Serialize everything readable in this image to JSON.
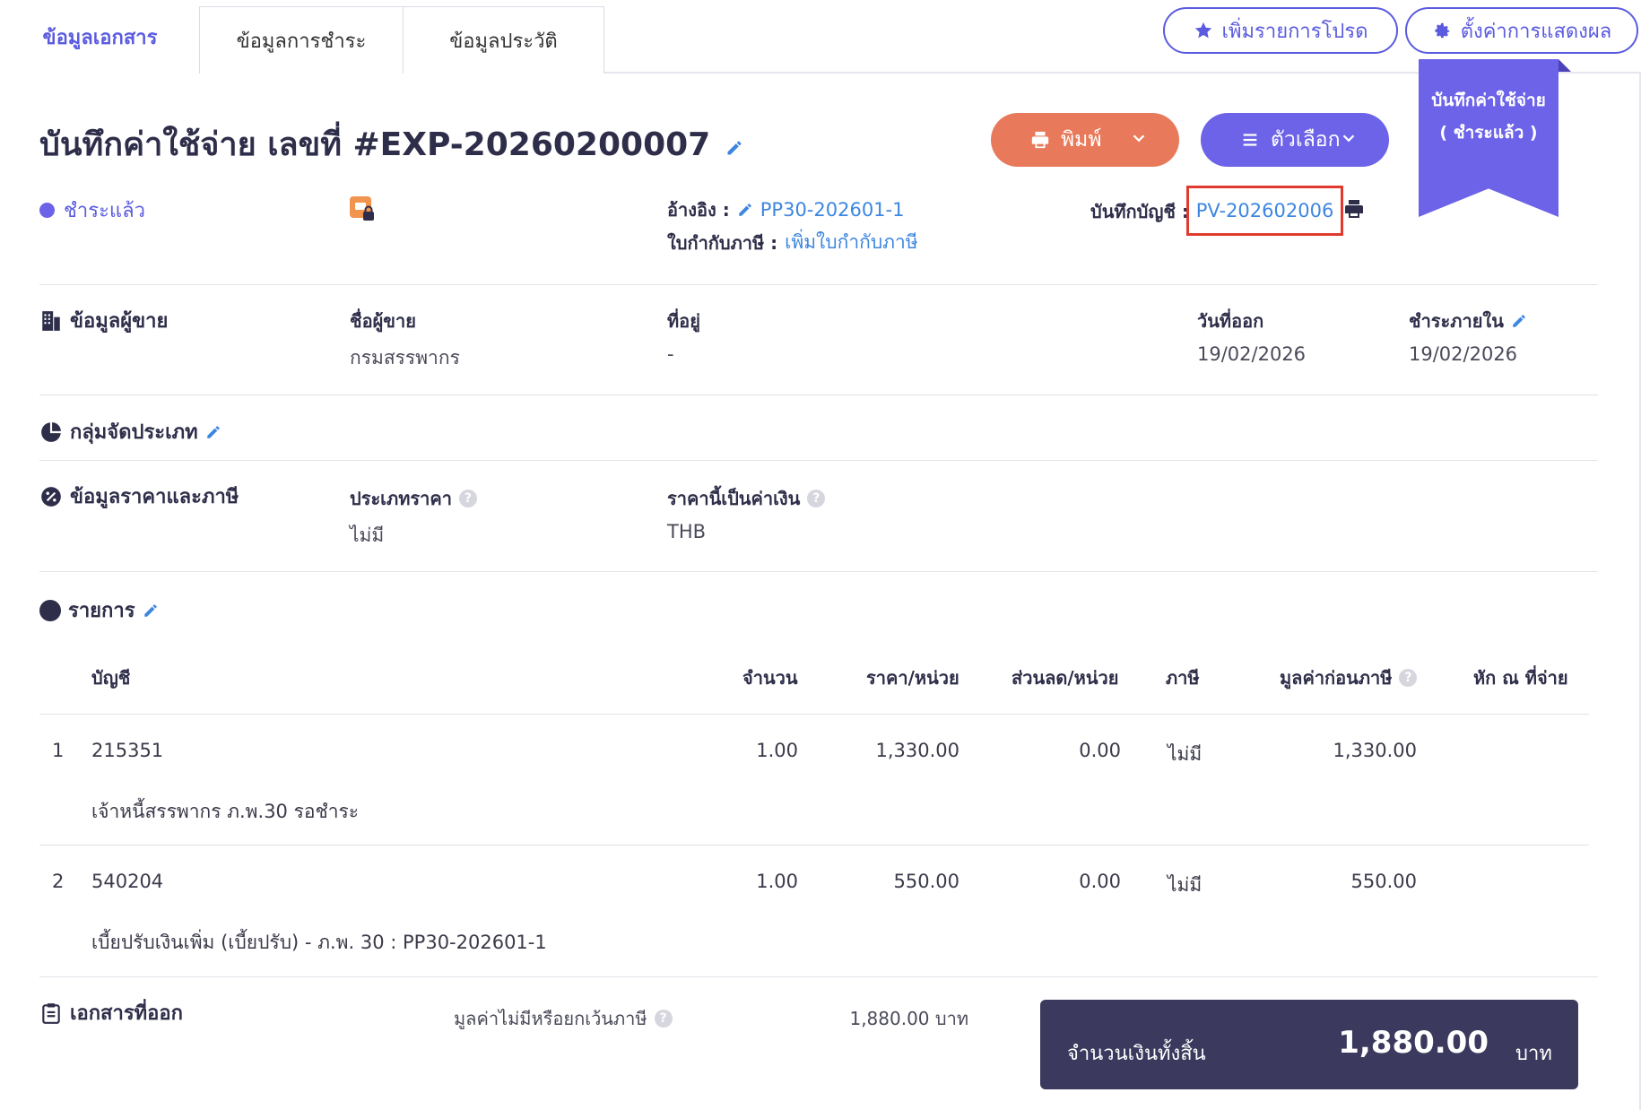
{
  "tabs": [
    "ข้อมูลเอกสาร",
    "ข้อมูลการชำระ",
    "ข้อมูลประวัติ"
  ],
  "top_buttons": {
    "favorite": "เพิ่มรายการโปรด",
    "display_settings": "ตั้งค่าการแสดงผล"
  },
  "ribbon": {
    "line1": "บันทึกค่าใช้จ่าย",
    "line2": "( ชำระแล้ว )"
  },
  "header": {
    "title": "บันทึกค่าใช้จ่าย เลขที่ #EXP-20260200007",
    "print_label": "พิมพ์",
    "options_label": "ตัวเลือก",
    "status": "ชำระแล้ว",
    "reference_label": "อ้างอิง :",
    "reference_value": "PP30-202601-1",
    "tax_invoice_label": "ใบกำกับภาษี :",
    "tax_invoice_value": "เพิ่มใบกำกับภาษี",
    "journal_label": "บันทึกบัญชี :",
    "journal_value": "PV-202602006"
  },
  "vendor": {
    "section": "ข้อมูลผู้ขาย",
    "name_label": "ชื่อผู้ขาย",
    "name_value": "กรมสรรพากร",
    "address_label": "ที่อยู่",
    "address_value": "-",
    "issue_date_label": "วันที่ออก",
    "issue_date_value": "19/02/2026",
    "due_label": "ชำระภายใน",
    "due_value": "19/02/2026"
  },
  "category": {
    "section": "กลุ่มจัดประเภท"
  },
  "pricing": {
    "section": "ข้อมูลราคาและภาษี",
    "price_type_label": "ประเภทราคา",
    "price_type_value": "ไม่มี",
    "currency_label": "ราคานี้เป็นค่าเงิน",
    "currency_value": "THB"
  },
  "items": {
    "section": "รายการ",
    "columns": {
      "account": "บัญชี",
      "qty": "จำนวน",
      "unit_price": "ราคา/หน่วย",
      "discount": "ส่วนลด/หน่วย",
      "tax": "ภาษี",
      "pretax": "มูลค่าก่อนภาษี",
      "wht": "หัก ณ ที่จ่าย"
    },
    "rows": [
      {
        "no": "1",
        "account": "215351",
        "qty": "1.00",
        "unit_price": "1,330.00",
        "discount": "0.00",
        "tax": "ไม่มี",
        "pretax": "1,330.00",
        "desc": "เจ้าหนี้สรรพากร ภ.พ.30 รอชำระ"
      },
      {
        "no": "2",
        "account": "540204",
        "qty": "1.00",
        "unit_price": "550.00",
        "discount": "0.00",
        "tax": "ไม่มี",
        "pretax": "550.00",
        "desc": "เบี้ยปรับเงินเพิ่ม (เบี้ยปรับ) - ภ.พ. 30 : PP30-202601-1"
      }
    ]
  },
  "summary": {
    "section": "เอกสารที่ออก",
    "non_taxable_label": "มูลค่าไม่มีหรือยกเว้นภาษี",
    "non_taxable_value": "1,880.00 บาท",
    "total_label": "จำนวนเงินทั้งสิ้น",
    "total_value": "1,880.00",
    "currency": "บาท"
  },
  "colors": {
    "accent": "#5b5be0",
    "print_btn": "#e8795a",
    "options_btn": "#6c63e8",
    "link": "#3d86e0",
    "highlight": "#e03a2e",
    "total_bg": "#3b3a5e"
  }
}
